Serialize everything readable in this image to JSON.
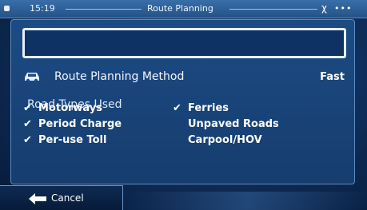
{
  "status_bar": {
    "time": "15:19",
    "title": "Route Planning",
    "signal_text": "χ",
    "dots_text": "•••"
  },
  "search": {
    "value": "",
    "placeholder": ""
  },
  "method": {
    "label": "Route Planning Method",
    "value": "Fast",
    "icon": "car-icon"
  },
  "road_types": {
    "title": "Road Types Used",
    "left": [
      {
        "label": "Motorways",
        "checked": true
      },
      {
        "label": "Period Charge",
        "checked": true
      },
      {
        "label": "Per-use Toll",
        "checked": true
      }
    ],
    "right": [
      {
        "label": "Ferries",
        "checked": true
      },
      {
        "label": "Unpaved Roads",
        "checked": false
      },
      {
        "label": "Carpool/HOV",
        "checked": false
      }
    ]
  },
  "footer": {
    "cancel_label": "Cancel",
    "icon": "back-arrow-icon"
  },
  "colors": {
    "background": "#0f2f5c",
    "panel": "#1c4b84",
    "border": "#5d8bc2",
    "text": "#ffffff"
  }
}
